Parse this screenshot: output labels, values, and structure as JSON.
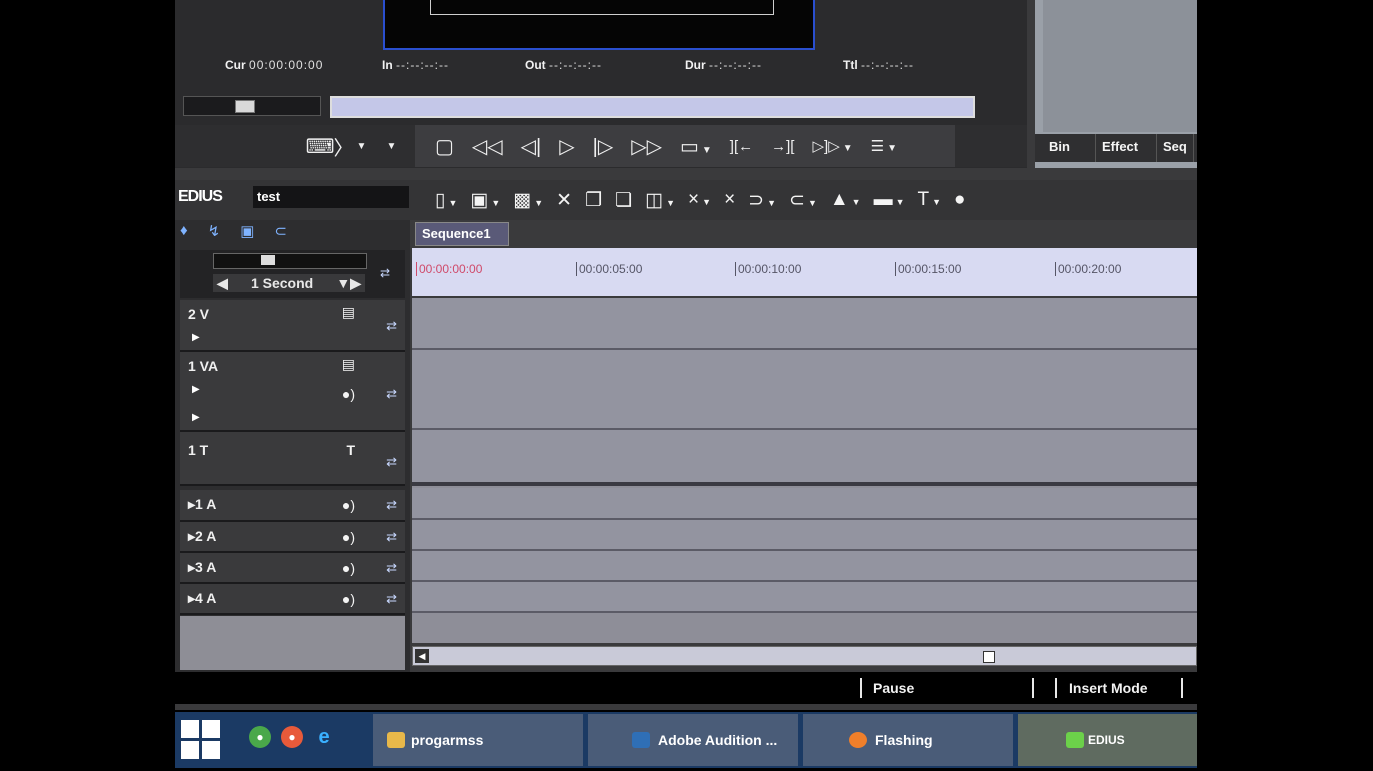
{
  "player": {
    "timecodes": [
      {
        "label": "Cur",
        "value": "00:00:00:00"
      },
      {
        "label": "In",
        "value": "--:--:--:--"
      },
      {
        "label": "Out",
        "value": "--:--:--:--"
      },
      {
        "label": "Dur",
        "value": "--:--:--:--"
      },
      {
        "label": "Ttl",
        "value": "--:--:--:--"
      }
    ]
  },
  "bin": {
    "tabs": [
      "Bin",
      "Effect",
      "Seq"
    ]
  },
  "timeline": {
    "app_logo": "EDIUS",
    "project_name": "test",
    "sequence_tab": "Sequence1",
    "zoom": "1 Second",
    "ruler": [
      "00:00:00:00",
      "00:00:05:00",
      "00:00:10:00",
      "00:00:15:00",
      "00:00:20:00"
    ],
    "tracks": [
      {
        "label": "2 V",
        "type": "video"
      },
      {
        "label": "1 VA",
        "type": "video-audio"
      },
      {
        "label": "1 T",
        "type": "title"
      },
      {
        "label": "1 A",
        "type": "audio"
      },
      {
        "label": "2 A",
        "type": "audio"
      },
      {
        "label": "3 A",
        "type": "audio"
      },
      {
        "label": "4 A",
        "type": "audio"
      }
    ]
  },
  "status": {
    "state": "Pause",
    "mode": "Insert Mode"
  },
  "taskbar": {
    "items": [
      {
        "label": "progarmss",
        "icon": "folder-icon",
        "color": "#e8b84a"
      },
      {
        "label": "Adobe Audition ...",
        "icon": "audition-icon",
        "color": "#2f6fb6"
      },
      {
        "label": "Flashing",
        "icon": "flash-icon",
        "color": "#f07f2a"
      },
      {
        "label": "EDIUS",
        "icon": "edius-icon",
        "color": "#6cd14a"
      }
    ]
  }
}
